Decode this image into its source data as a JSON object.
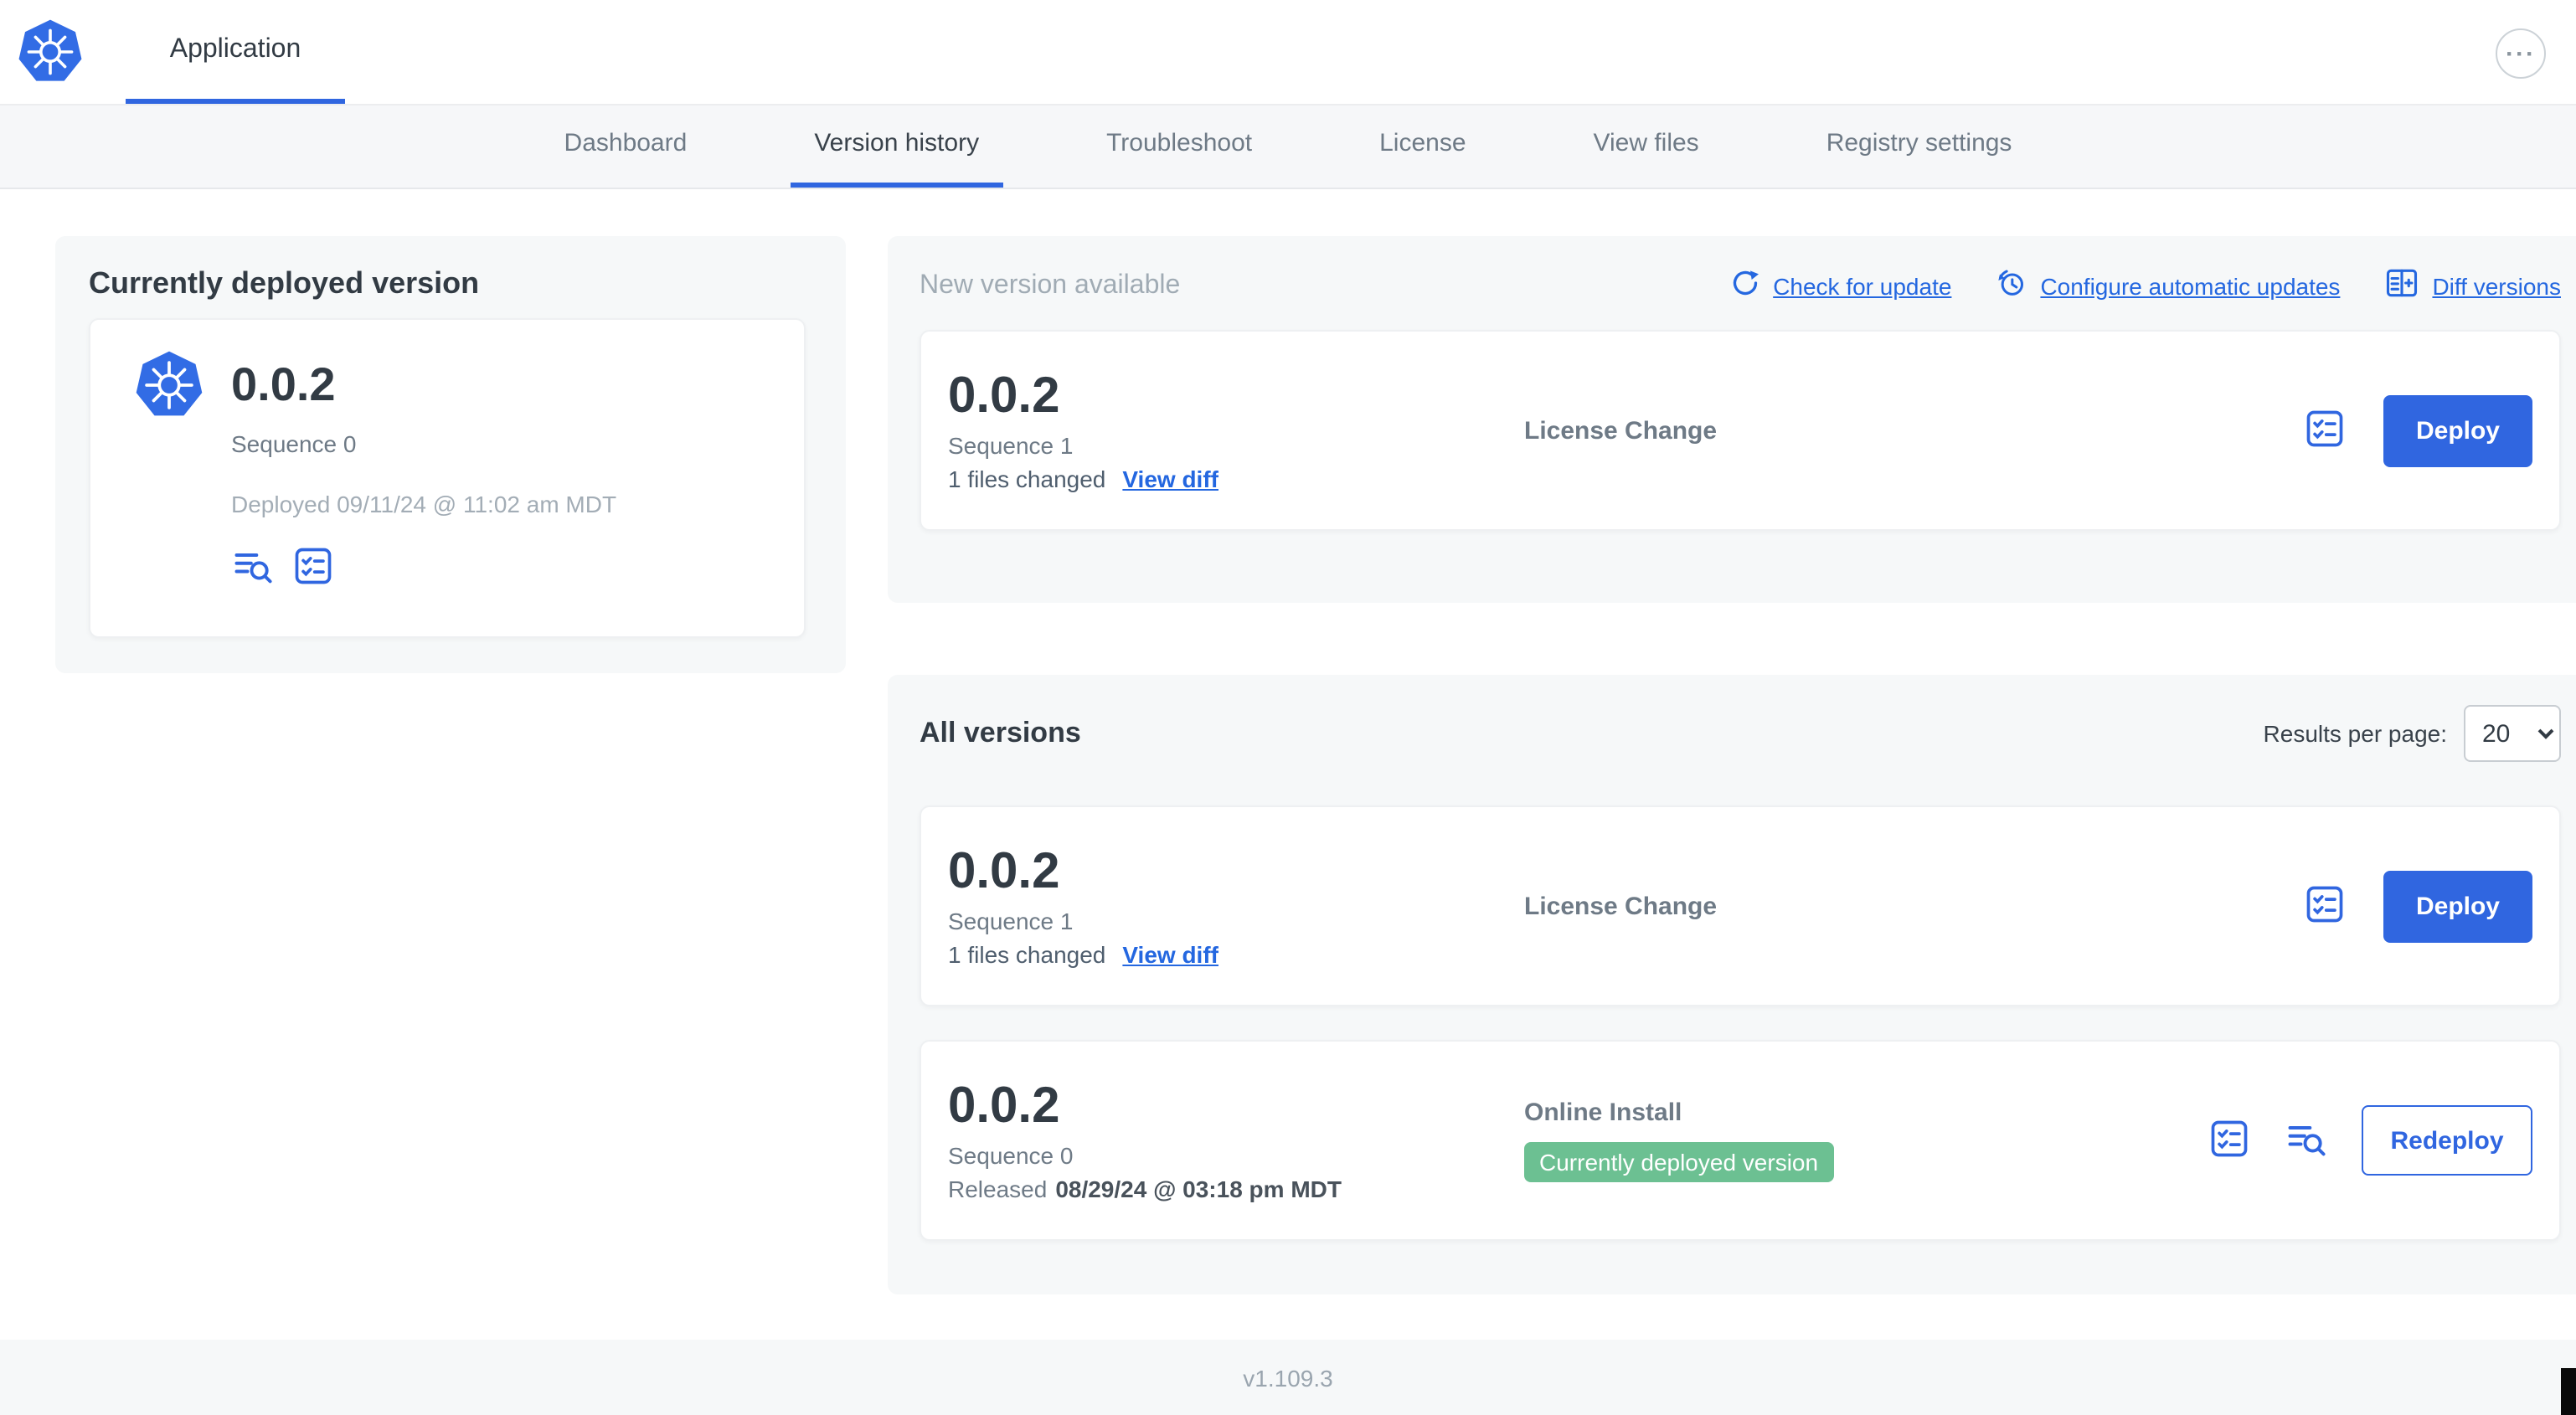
{
  "topbar": {
    "app_tab": "Application"
  },
  "icons": {
    "ellipsis": "···"
  },
  "nav": {
    "tabs": [
      {
        "label": "Dashboard"
      },
      {
        "label": "Version history"
      },
      {
        "label": "Troubleshoot"
      },
      {
        "label": "License"
      },
      {
        "label": "View files"
      },
      {
        "label": "Registry settings"
      }
    ]
  },
  "deployed": {
    "title": "Currently deployed version",
    "version": "0.0.2",
    "sequence": "Sequence 0",
    "deployed_at": "Deployed 09/11/24 @ 11:02 am MDT"
  },
  "new_version": {
    "title": "New version available",
    "check_for_update": "Check for update",
    "configure_auto_updates": "Configure automatic updates",
    "diff_versions": "Diff versions",
    "card": {
      "version": "0.0.2",
      "sequence": "Sequence 1",
      "files_changed": "1 files changed",
      "view_diff": "View diff",
      "source": "License Change",
      "deploy": "Deploy"
    }
  },
  "all_versions": {
    "title": "All versions",
    "results_per_page_label": "Results per page:",
    "results_per_page": "20",
    "rows": [
      {
        "version": "0.0.2",
        "sequence": "Sequence 1",
        "files_changed": "1 files changed",
        "view_diff": "View diff",
        "source": "License Change",
        "action": "Deploy"
      },
      {
        "version": "0.0.2",
        "sequence": "Sequence 0",
        "released_label": "Released",
        "released_date": "08/29/24 @ 03:18 pm MDT",
        "source": "Online Install",
        "badge": "Currently deployed version",
        "action": "Redeploy"
      }
    ]
  },
  "footer": {
    "version": "v1.109.3"
  },
  "colors": {
    "accent_blue": "#3066e0",
    "link_blue": "#2467e0",
    "kubernetes_blue": "#326ce5",
    "badge_green": "#6cc092",
    "panel_gray": "#f6f8f9",
    "muted_text": "#9aa5af"
  }
}
